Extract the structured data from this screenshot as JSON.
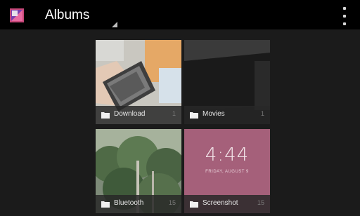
{
  "actionbar": {
    "title": "Albums",
    "app_icon": "gallery-icon",
    "overflow_icon": "overflow-menu-icon"
  },
  "albums": [
    {
      "name": "Download",
      "count": "1",
      "thumb": "hand-holding-phone"
    },
    {
      "name": "Movies",
      "count": "1",
      "thumb": "dark-screen"
    },
    {
      "name": "Bluetooth",
      "count": "15",
      "thumb": "trees"
    },
    {
      "name": "Screenshot",
      "count": "15",
      "thumb": "lockscreen-clock"
    }
  ],
  "lockscreen": {
    "time": "4:44",
    "date": "FRIDAY, AUGUST 9"
  },
  "colors": {
    "actionbar_bg": "#000000",
    "content_bg": "#1b1b1b",
    "label_bar": "#282828",
    "lockscreen_pink": "#9e5a73"
  }
}
